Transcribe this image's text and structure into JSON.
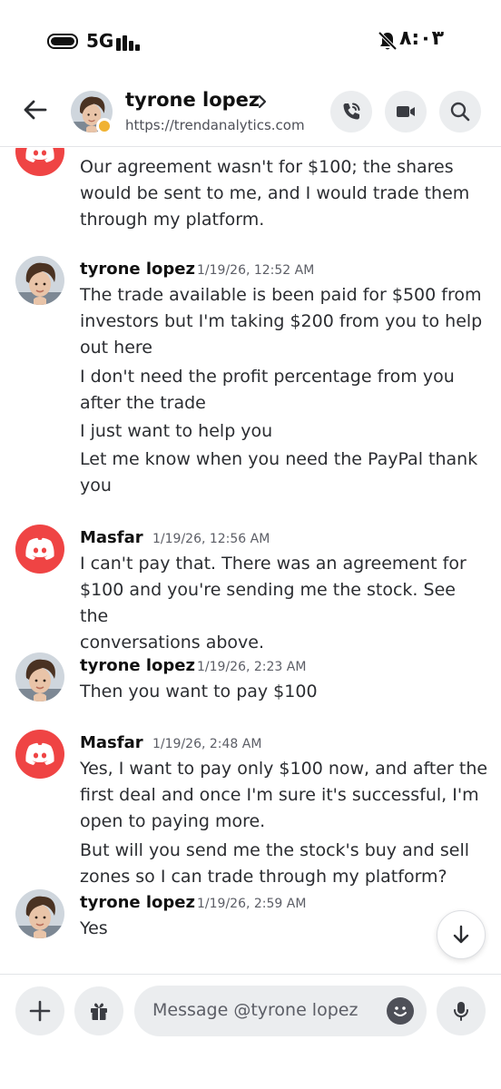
{
  "status_bar": {
    "network": "5G",
    "time": "٨:٠٣",
    "icons": [
      "battery-icon",
      "signal-icon",
      "mute-icon"
    ]
  },
  "header": {
    "contact_name": "tyrone lopez",
    "contact_status": "https://trendanalytics.com",
    "icons": [
      "back-arrow-icon",
      "chevron-right-icon",
      "phone-call-icon",
      "video-camera-icon",
      "search-icon"
    ]
  },
  "messages": [
    {
      "author": "",
      "timestamp": "",
      "avatar": "discord-logo",
      "lines": [
        "Our agreement wasn't for $100; the shares\nwould be sent to me, and I would trade them\nthrough my platform."
      ]
    },
    {
      "author": "tyrone lopez",
      "timestamp": "1/19/26, 12:52 AM",
      "avatar": "user-photo",
      "lines": [
        "The trade available is been paid for $500 from\ninvestors but I'm taking $200 from you to help\nout here",
        "I don't need the profit percentage from you\nafter the trade",
        "I just want to help you",
        "Let me know when you need the PayPal thank\nyou"
      ]
    },
    {
      "author": "Masfar",
      "timestamp": "1/19/26, 12:56 AM",
      "avatar": "discord-logo",
      "lines": [
        "I can't pay that. There was an agreement for\n$100 and you're sending me the stock. See the\nconversations above."
      ]
    },
    {
      "author": "tyrone lopez",
      "timestamp": "1/19/26, 2:23 AM",
      "avatar": "user-photo",
      "lines": [
        "Then you want to pay $100"
      ]
    },
    {
      "author": "Masfar",
      "timestamp": "1/19/26, 2:48 AM",
      "avatar": "discord-logo",
      "lines": [
        "Yes, I want to pay only $100 now, and after the\nfirst deal and once I'm sure it's successful, I'm\nopen to paying more.",
        "But will you send me the stock's buy and sell\nzones so I can trade through my platform?"
      ]
    },
    {
      "author": "tyrone lopez",
      "timestamp": "1/19/26, 2:59 AM",
      "avatar": "user-photo",
      "lines": [
        "Yes"
      ]
    }
  ],
  "composer": {
    "placeholder": "Message @tyrone lopez",
    "icons": [
      "plus-icon",
      "gift-icon",
      "emoji-icon",
      "microphone-icon",
      "arrow-down-icon"
    ]
  },
  "colors": {
    "discord_red": "#ef4444",
    "idle_status": "#f0b232",
    "button_bg": "#ebedef"
  }
}
